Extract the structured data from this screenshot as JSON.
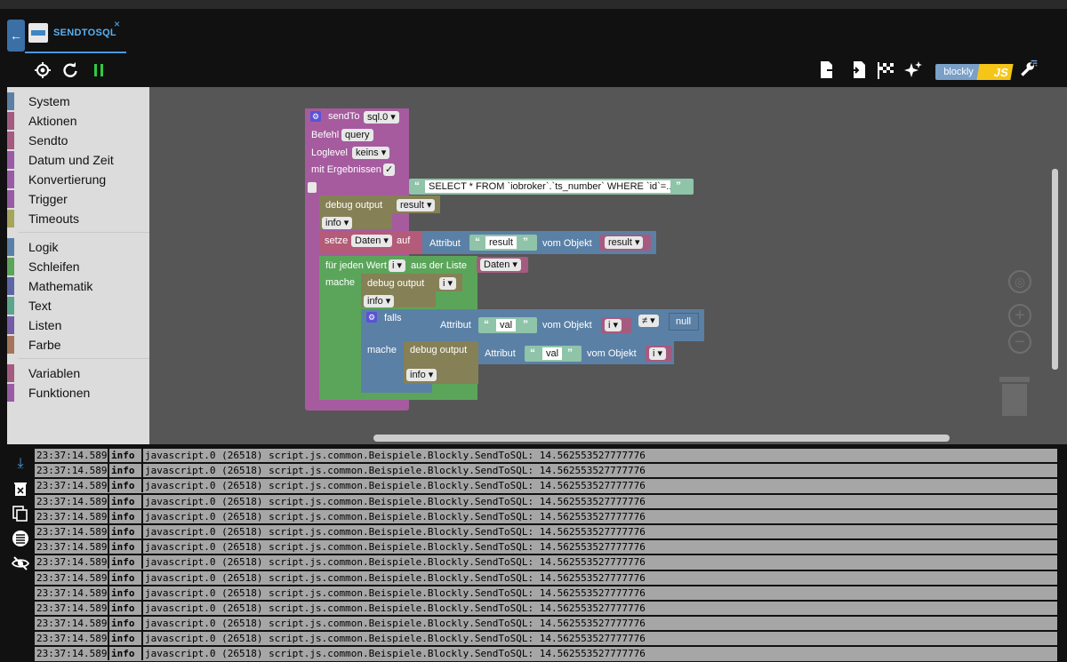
{
  "tab": {
    "label": "SENDTOSQL",
    "close": "×",
    "back": "←"
  },
  "toolbar": {
    "left_icons": [
      "crosshair-icon",
      "refresh-icon",
      "pause-icon"
    ],
    "right_icons": [
      "export-icon",
      "import-icon",
      "checkered-flag-icon",
      "sparkle-icon"
    ],
    "blockly_label": "blockly",
    "js_label": "JS"
  },
  "categories": {
    "group1": [
      {
        "label": "System",
        "color": "#5b80a5"
      },
      {
        "label": "Aktionen",
        "color": "#a55b80"
      },
      {
        "label": "Sendto",
        "color": "#a55b80"
      },
      {
        "label": "Datum und Zeit",
        "color": "#995ba5"
      },
      {
        "label": "Konvertierung",
        "color": "#995ba5"
      },
      {
        "label": "Trigger",
        "color": "#995ba5"
      },
      {
        "label": "Timeouts",
        "color": "#a5a55b"
      }
    ],
    "group2": [
      {
        "label": "Logik",
        "color": "#5b80a5"
      },
      {
        "label": "Schleifen",
        "color": "#5ba55b"
      },
      {
        "label": "Mathematik",
        "color": "#5b67a5"
      },
      {
        "label": "Text",
        "color": "#5ba58c"
      },
      {
        "label": "Listen",
        "color": "#745ba5"
      },
      {
        "label": "Farbe",
        "color": "#a5745b"
      }
    ],
    "group3": [
      {
        "label": "Variablen",
        "color": "#a55b80"
      },
      {
        "label": "Funktionen",
        "color": "#995ba5"
      }
    ]
  },
  "blocks": {
    "sendto": {
      "label": "sendTo",
      "instance": "sql.0 ▾",
      "befehl": "Befehl",
      "befehl_val": "query",
      "loglevel": "Loglevel",
      "loglevel_val": "keins ▾",
      "mit": "mit Ergebnissen",
      "check": "✓"
    },
    "sql": "SELECT * FROM `iobroker`.`ts_number` WHERE `id`=...",
    "debug1": {
      "label": "debug output",
      "var": "result ▾",
      "level": "info ▾"
    },
    "setze": {
      "label": "setze",
      "var": "Daten ▾",
      "auf": "auf",
      "attr": "Attribut",
      "attr_val": "result",
      "vom": "vom Objekt",
      "obj": "result ▾"
    },
    "foreach": {
      "label": "für jeden Wert",
      "var": "i ▾",
      "aus": "aus der Liste",
      "list": "Daten ▾",
      "mache": "mache"
    },
    "debug2": {
      "label": "debug output",
      "var": "i ▾",
      "level": "info ▾"
    },
    "falls": {
      "label": "falls",
      "attr": "Attribut",
      "attr_val": "val",
      "vom": "vom Objekt",
      "obj": "i ▾",
      "op": "≠ ▾",
      "null": "null",
      "mache": "mache"
    },
    "debug3": {
      "label": "debug output",
      "attr": "Attribut",
      "attr_val": "val",
      "vom": "vom Objekt",
      "obj": "i ▾",
      "level": "info ▾"
    }
  },
  "log": {
    "rows": [
      {
        "time": "23:37:14.589",
        "level": "info",
        "msg": "javascript.0 (26518) script.js.common.Beispiele.Blockly.SendToSQL: 14.562553527777776"
      },
      {
        "time": "23:37:14.589",
        "level": "info",
        "msg": "javascript.0 (26518) script.js.common.Beispiele.Blockly.SendToSQL: 14.562553527777776"
      },
      {
        "time": "23:37:14.589",
        "level": "info",
        "msg": "javascript.0 (26518) script.js.common.Beispiele.Blockly.SendToSQL: 14.562553527777776"
      },
      {
        "time": "23:37:14.589",
        "level": "info",
        "msg": "javascript.0 (26518) script.js.common.Beispiele.Blockly.SendToSQL: 14.562553527777776"
      },
      {
        "time": "23:37:14.589",
        "level": "info",
        "msg": "javascript.0 (26518) script.js.common.Beispiele.Blockly.SendToSQL: 14.562553527777776"
      },
      {
        "time": "23:37:14.589",
        "level": "info",
        "msg": "javascript.0 (26518) script.js.common.Beispiele.Blockly.SendToSQL: 14.562553527777776"
      },
      {
        "time": "23:37:14.589",
        "level": "info",
        "msg": "javascript.0 (26518) script.js.common.Beispiele.Blockly.SendToSQL: 14.562553527777776"
      },
      {
        "time": "23:37:14.589",
        "level": "info",
        "msg": "javascript.0 (26518) script.js.common.Beispiele.Blockly.SendToSQL: 14.562553527777776"
      },
      {
        "time": "23:37:14.589",
        "level": "info",
        "msg": "javascript.0 (26518) script.js.common.Beispiele.Blockly.SendToSQL: 14.562553527777776"
      },
      {
        "time": "23:37:14.589",
        "level": "info",
        "msg": "javascript.0 (26518) script.js.common.Beispiele.Blockly.SendToSQL: 14.562553527777776"
      },
      {
        "time": "23:37:14.589",
        "level": "info",
        "msg": "javascript.0 (26518) script.js.common.Beispiele.Blockly.SendToSQL: 14.562553527777776"
      },
      {
        "time": "23:37:14.589",
        "level": "info",
        "msg": "javascript.0 (26518) script.js.common.Beispiele.Blockly.SendToSQL: 14.562553527777776"
      },
      {
        "time": "23:37:14.589",
        "level": "info",
        "msg": "javascript.0 (26518) script.js.common.Beispiele.Blockly.SendToSQL: 14.562553527777776"
      },
      {
        "time": "23:37:14.589",
        "level": "info",
        "msg": "javascript.0 (26518) script.js.common.Beispiele.Blockly.SendToSQL: 14.562553527777776"
      }
    ]
  }
}
